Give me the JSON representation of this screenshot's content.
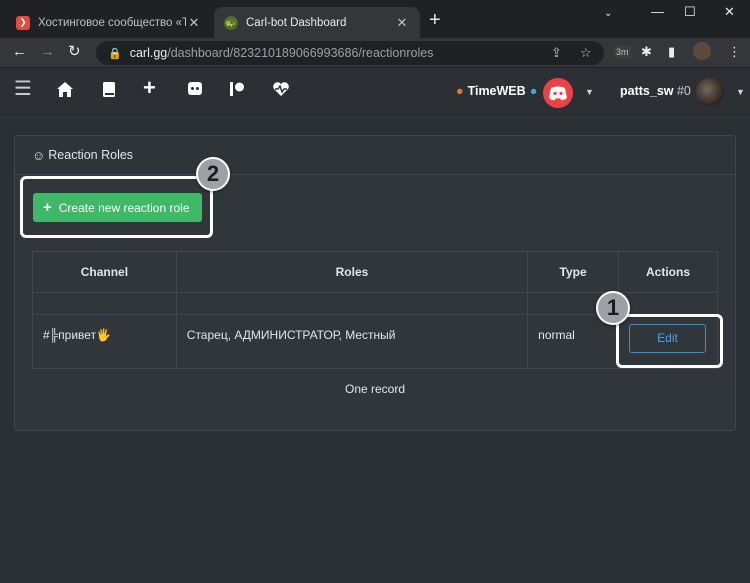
{
  "browser": {
    "tabs": [
      {
        "title": "Хостинговое сообщество «Time",
        "active": false,
        "favicon_color": "#e34b3e"
      },
      {
        "title": "Carl-bot Dashboard",
        "active": true,
        "favicon_color": "#4f6b2e"
      }
    ],
    "url_host": "carl.gg",
    "url_path": "/dashboard/823210189066993686/reactionroles",
    "extension_badge": "3m"
  },
  "header": {
    "server_name": "TimeWEB",
    "username": "patts_sw",
    "user_tag": "#0",
    "discord_color": "#ed4245"
  },
  "panel": {
    "title": "Reaction Roles",
    "create_button": "Create new reaction role"
  },
  "table": {
    "columns": [
      "Channel",
      "Roles",
      "Type",
      "Actions"
    ],
    "rows": [
      {
        "channel": "#╠привет🖐",
        "roles": "Старец, АДМИНИСТРАТОР, Местный",
        "type": "normal",
        "action": "Edit"
      }
    ]
  },
  "records_text": "One record",
  "callouts": {
    "edit": "1",
    "create": "2"
  },
  "colors": {
    "accent_green": "#3fb868",
    "accent_blue": "#3391d9",
    "bg": "#2b3035"
  }
}
